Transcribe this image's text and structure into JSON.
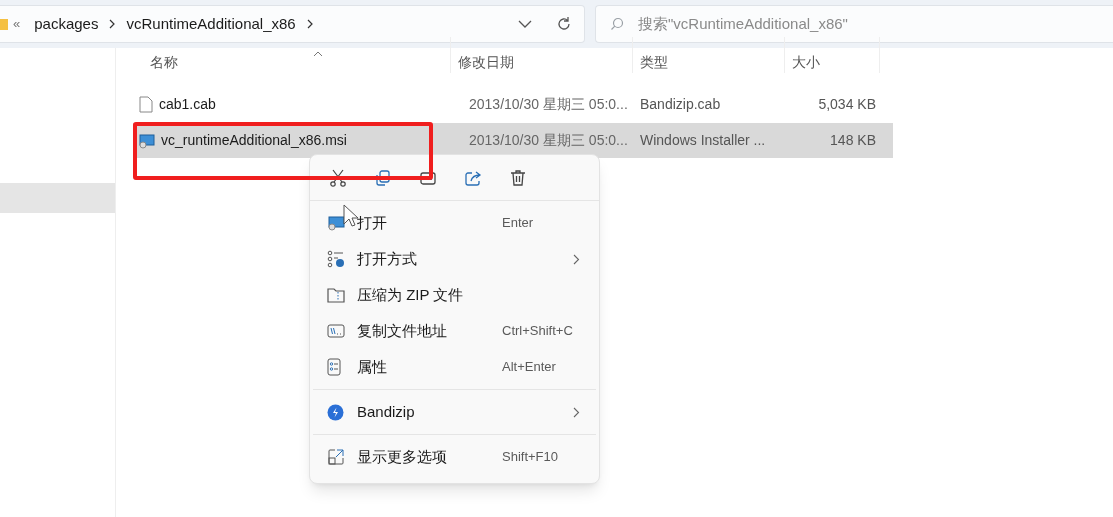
{
  "address_bar": {
    "overflow": "«",
    "crumbs": [
      "packages",
      "vcRuntimeAdditional_x86"
    ]
  },
  "search": {
    "placeholder": "搜索\"vcRuntimeAdditional_x86\""
  },
  "nav_pane": {
    "items": [
      {
        "selected": true
      }
    ]
  },
  "table": {
    "columns": [
      "名称",
      "修改日期",
      "类型",
      "大小"
    ],
    "rows": [
      {
        "kind": "file",
        "name": "cab1.cab",
        "date": "2013/10/30 星期三 05:0...",
        "type": "Bandizip.cab",
        "size": "5,034 KB",
        "selected": false
      },
      {
        "kind": "installer",
        "name": "vc_runtimeAdditional_x86.msi",
        "date": "2013/10/30 星期三 05:0...",
        "type": "Windows Installer ...",
        "size": "148 KB",
        "selected": true
      }
    ]
  },
  "context_menu": {
    "groups": [
      [
        {
          "label": "打开",
          "shortcut": "Enter",
          "submenu": false
        },
        {
          "label": "打开方式",
          "submenu": true
        },
        {
          "label": "压缩为 ZIP 文件",
          "submenu": false
        },
        {
          "label": "复制文件地址",
          "shortcut": "Ctrl+Shift+C",
          "submenu": false
        },
        {
          "label": "属性",
          "shortcut": "Alt+Enter",
          "submenu": false
        }
      ],
      [
        {
          "label": "Bandizip",
          "submenu": true
        }
      ],
      [
        {
          "label": "显示更多选项",
          "shortcut": "Shift+F10",
          "submenu": false
        }
      ]
    ]
  }
}
